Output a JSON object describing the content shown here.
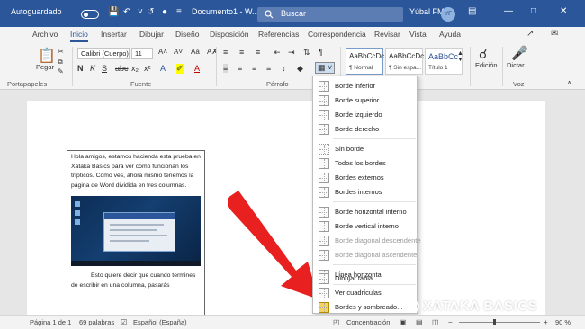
{
  "titlebar": {
    "autosave": "Autoguardado",
    "document": "Documento1 - W...",
    "search_placeholder": "Buscar",
    "user": "Yúbal FM",
    "avatar_initials": "YF"
  },
  "tabs": [
    "Archivo",
    "Inicio",
    "Insertar",
    "Dibujar",
    "Diseño",
    "Disposición",
    "Referencias",
    "Correspondencia",
    "Revisar",
    "Vista",
    "Ayuda"
  ],
  "ribbon": {
    "paste_label": "Pegar",
    "font_name": "Calibri (Cuerpo)",
    "font_size": "11",
    "styles": [
      {
        "preview": "AaBbCcDc",
        "name": "¶ Normal"
      },
      {
        "preview": "AaBbCcDc",
        "name": "¶ Sin espa..."
      },
      {
        "preview": "AaBbCc",
        "name": "Título 1"
      }
    ],
    "editing_label": "Edición",
    "dictate_label": "Dictar",
    "groups": {
      "clipboard": "Portapapeles",
      "font": "Fuente",
      "paragraph": "Párrafo",
      "voice": "Voz"
    }
  },
  "document": {
    "intro": "Hola amigos, estamos hacienda esta prueba en Xataka Basics para ver cómo funcionan los trípticos. Como ves, ahora mismo tenemos la página de Word dividida en tres columnas.",
    "outro": "Esto quiere decir que cuando termines de escribir en una columna, pasarás"
  },
  "border_menu": {
    "items": [
      {
        "label": "Borde inferior",
        "enabled": true
      },
      {
        "label": "Borde superior",
        "enabled": true
      },
      {
        "label": "Borde izquierdo",
        "enabled": true
      },
      {
        "label": "Borde derecho",
        "enabled": true
      },
      {
        "label": "Sin borde",
        "enabled": true
      },
      {
        "label": "Todos los bordes",
        "enabled": true
      },
      {
        "label": "Bordes externos",
        "enabled": true
      },
      {
        "label": "Bordes internos",
        "enabled": true
      },
      {
        "label": "Borde horizontal interno",
        "enabled": true
      },
      {
        "label": "Borde vertical interno",
        "enabled": true
      },
      {
        "label": "Borde diagonal descendente",
        "enabled": false
      },
      {
        "label": "Borde diagonal ascendente",
        "enabled": false
      },
      {
        "label": "Línea horizontal",
        "enabled": true
      },
      {
        "label": "Dibujar tabla",
        "enabled": true
      },
      {
        "label": "Ver cuadrículas",
        "enabled": true
      },
      {
        "label": "Bordes y sombreado...",
        "enabled": true
      }
    ]
  },
  "statusbar": {
    "page": "Página 1 de 1",
    "words": "69 palabras",
    "language": "Español (España)",
    "focus": "Concentración",
    "zoom": "90 %"
  },
  "watermark": {
    "text": "XATAKA BASICS"
  },
  "colors": {
    "accent": "#2b579a",
    "arrow": "#e8201f"
  }
}
